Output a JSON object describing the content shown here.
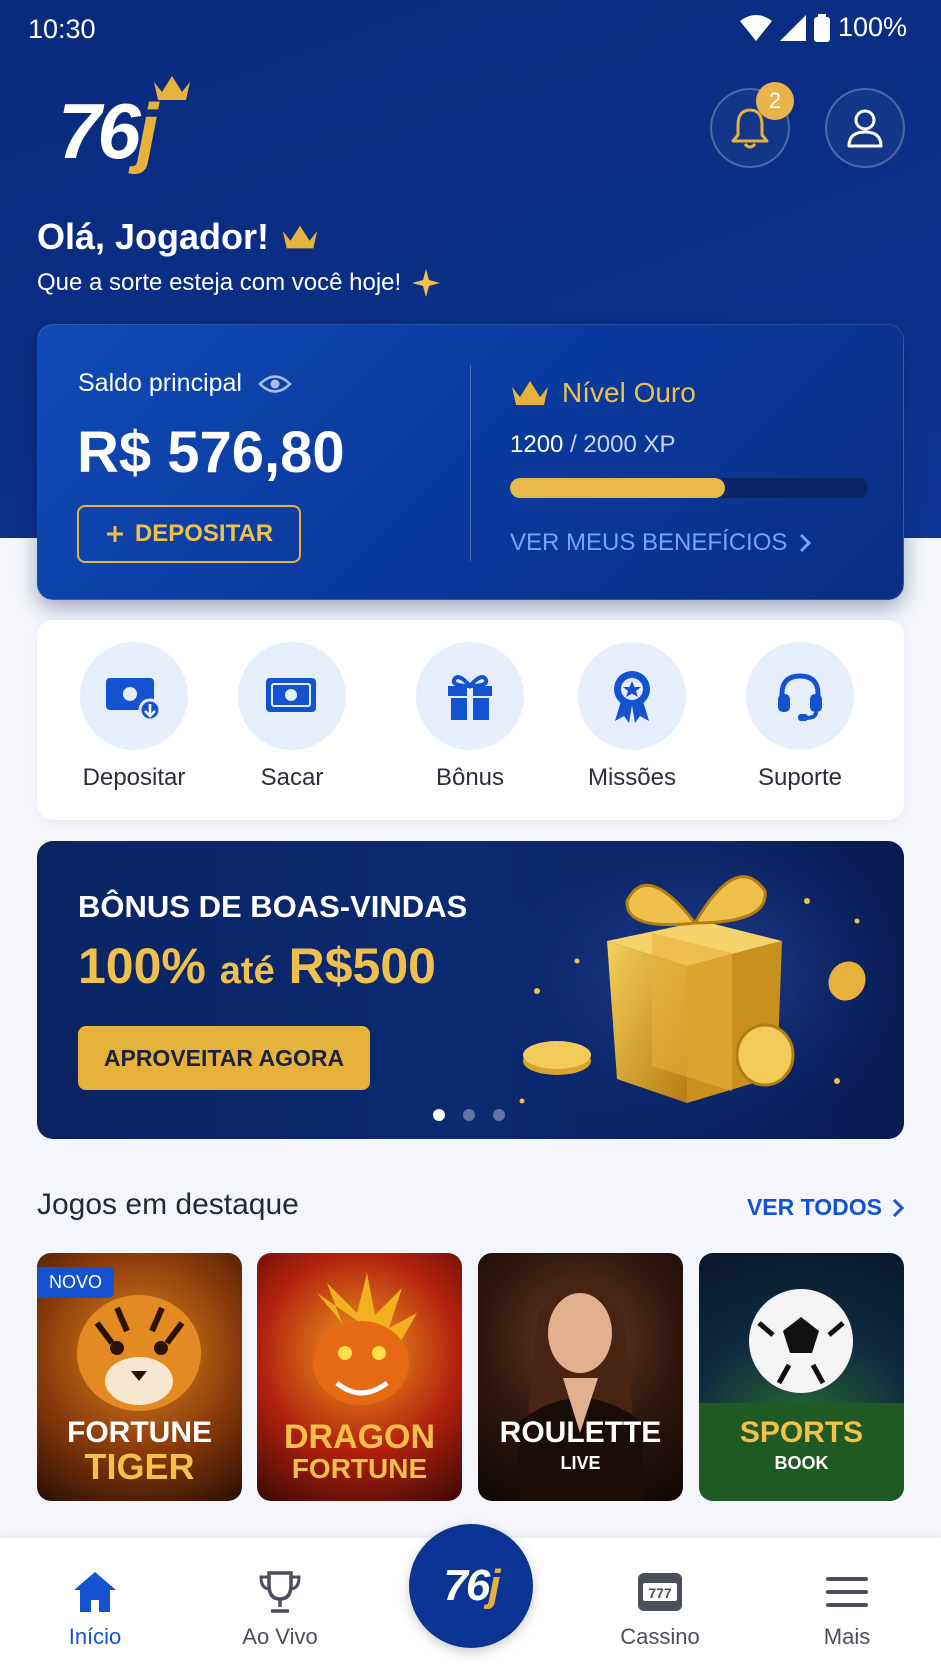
{
  "status_bar": {
    "time": "10:30",
    "battery": "100%"
  },
  "logo": {
    "text_main": "76",
    "text_accent": "j"
  },
  "header": {
    "notification_count": "2"
  },
  "greeting": {
    "title": "Olá, Jogador!",
    "subtitle": "Que a sorte esteja com você hoje!"
  },
  "balance": {
    "label": "Saldo principal",
    "amount": "R$ 576,80",
    "deposit_label": "DEPOSITAR",
    "level_label": "Nível Ouro",
    "xp_current": "1200",
    "xp_max": "/ 2000 XP",
    "xp_progress": 0.6,
    "benefits_label": "VER MEUS BENEFÍCIOS"
  },
  "quick_actions": [
    {
      "label": "Depositar",
      "icon": "deposit-icon"
    },
    {
      "label": "Sacar",
      "icon": "withdraw-icon"
    },
    {
      "label": "Bônus",
      "icon": "gift-icon"
    },
    {
      "label": "Missões",
      "icon": "medal-icon"
    },
    {
      "label": "Suporte",
      "icon": "headset-icon"
    }
  ],
  "promo": {
    "title": "BÔNUS DE BOAS-VINDAS",
    "offer_main": "100%",
    "offer_mid": "até",
    "offer_end": "R$500",
    "cta": "APROVEITAR AGORA",
    "slides": 3,
    "active_slide": 1
  },
  "games_section": {
    "title": "Jogos em destaque",
    "see_all": "VER TODOS",
    "games": [
      {
        "line1": "FORTUNE",
        "line2": "TIGER",
        "badge": "NOVO"
      },
      {
        "line1": "DRAGON",
        "line2": "FORTUNE"
      },
      {
        "line1": "ROULETTE",
        "line2": "LIVE"
      },
      {
        "line1": "SPORTS",
        "line2": "BOOK"
      }
    ]
  },
  "bottom_nav": {
    "items": [
      {
        "label": "Início",
        "icon": "home-icon",
        "active": true
      },
      {
        "label": "Ao Vivo",
        "icon": "trophy-icon"
      },
      {
        "label": "Cassino",
        "icon": "slot-machine-icon"
      },
      {
        "label": "Mais",
        "icon": "menu-icon"
      }
    ],
    "center_logo_main": "76",
    "center_logo_accent": "j"
  },
  "colors": {
    "primary": "#0b2f86",
    "accent": "#e6b23c",
    "link": "#1552d0"
  }
}
